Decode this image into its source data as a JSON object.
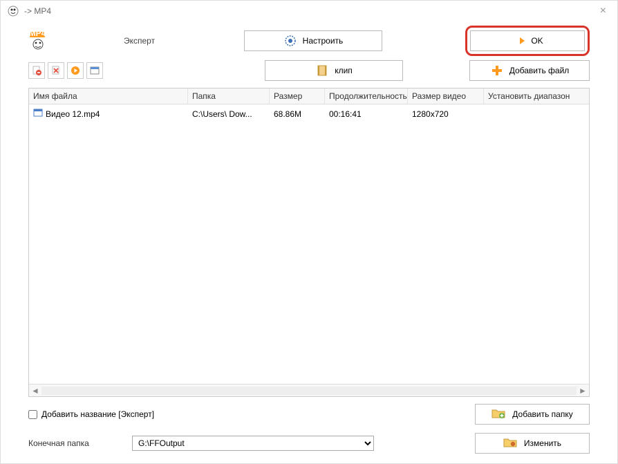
{
  "titlebar": {
    "title": "-> MP4"
  },
  "toolbar": {
    "mp4_badge": "MP4",
    "expert_label": "Эксперт",
    "configure_label": "Настроить",
    "ok_label": "OK",
    "clip_label": "клип",
    "add_file_label": "Добавить файл"
  },
  "table": {
    "headers": {
      "name": "Имя файла",
      "folder": "Папка",
      "size": "Размер",
      "duration": "Продолжительность",
      "video_size": "Размер видео",
      "range": "Установить диапазон"
    },
    "rows": [
      {
        "name": "Видео 12.mp4",
        "folder": "C:\\Users\\      Dow...",
        "size": "68.86M",
        "duration": "00:16:41",
        "video_size": "1280x720",
        "range": ""
      }
    ]
  },
  "bottom": {
    "add_title_label": "Добавить название [Эксперт]",
    "add_folder_label": "Добавить папку",
    "dest_label": "Конечная папка",
    "dest_value": "G:\\FFOutput",
    "change_label": "Изменить"
  }
}
